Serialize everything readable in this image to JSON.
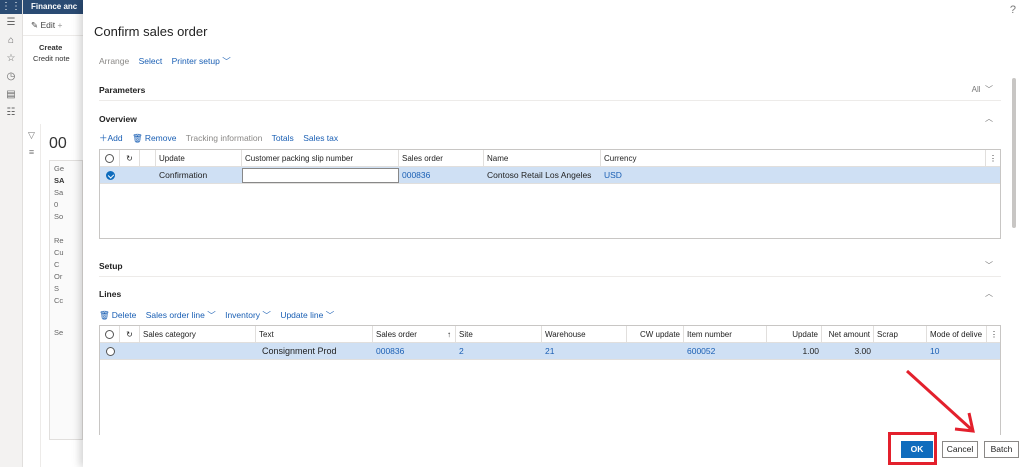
{
  "background": {
    "app_title": "Finance anc",
    "edit_label": "Edit",
    "create_label": "Create",
    "credit_note_label": "Credit note",
    "record_fragment": "00",
    "fragments": [
      "Ge",
      "SA",
      "Sa",
      "0",
      "So",
      "Re",
      "Cu",
      "C",
      "Or",
      "S",
      "Cc",
      "Se"
    ]
  },
  "dialog": {
    "title": "Confirm sales order",
    "help": "?",
    "actions": {
      "arrange": "Arrange",
      "select": "Select",
      "printer_setup": "Printer setup"
    },
    "parameters": {
      "title": "Parameters",
      "right_label": "All"
    },
    "overview": {
      "title": "Overview",
      "toolbar": {
        "add": "Add",
        "remove": "Remove",
        "tracking": "Tracking information",
        "totals": "Totals",
        "sales_tax": "Sales tax"
      },
      "columns": {
        "update": "Update",
        "packing_slip": "Customer packing slip number",
        "sales_order": "Sales order",
        "name": "Name",
        "currency": "Currency"
      },
      "rows": [
        {
          "update": "Confirmation",
          "packing_slip": "",
          "sales_order": "000836",
          "name": "Contoso Retail Los Angeles",
          "currency": "USD"
        }
      ]
    },
    "setup": {
      "title": "Setup"
    },
    "lines": {
      "title": "Lines",
      "toolbar": {
        "delete": "Delete",
        "sales_order_line": "Sales order line",
        "inventory": "Inventory",
        "update_line": "Update line"
      },
      "columns": {
        "sales_category": "Sales category",
        "text": "Text",
        "sales_order": "Sales order",
        "site": "Site",
        "warehouse": "Warehouse",
        "cw_update": "CW update",
        "item_number": "Item number",
        "update": "Update",
        "net_amount": "Net amount",
        "scrap": "Scrap",
        "mode_of_delivery": "Mode of delive"
      },
      "rows": [
        {
          "sales_category": "",
          "text": "Consignment Prod",
          "sales_order": "000836",
          "site": "2",
          "warehouse": "21",
          "cw_update": "",
          "item_number": "600052",
          "update": "1.00",
          "net_amount": "3.00",
          "scrap": "",
          "mode_of_delivery": "10"
        }
      ]
    },
    "buttons": {
      "ok": "OK",
      "cancel": "Cancel",
      "batch": "Batch"
    },
    "colors": {
      "primary": "#0f6cbd",
      "link": "#1a5fb4",
      "selected_row": "#cfe0f4",
      "highlight": "#e3202c",
      "header_bar": "#2a4b73"
    }
  }
}
